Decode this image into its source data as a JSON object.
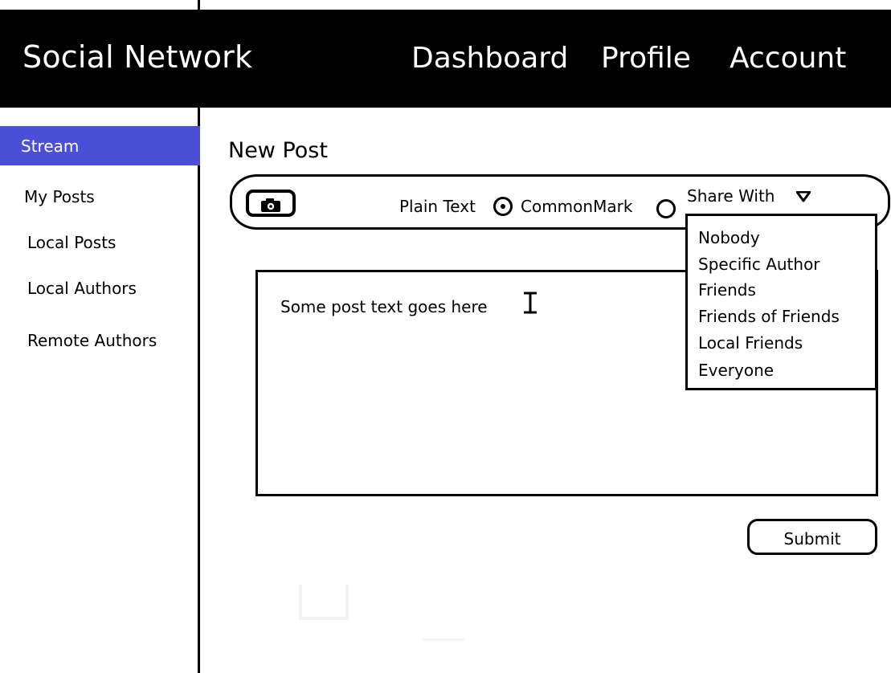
{
  "header": {
    "brand": "Social Network",
    "nav": [
      "Dashboard",
      "Profile",
      "Account"
    ]
  },
  "sidebar": {
    "items": [
      {
        "label": "Stream",
        "active": true
      },
      {
        "label": "My Posts",
        "active": false
      },
      {
        "label": "Local Posts",
        "active": false
      },
      {
        "label": "Local Authors",
        "active": false
      },
      {
        "label": "Remote Authors",
        "active": false
      }
    ]
  },
  "main": {
    "title": "New Post",
    "toolbar": {
      "camera_icon": "camera-icon",
      "format_options": [
        {
          "label": "Plain Text",
          "selected": true
        },
        {
          "label": "CommonMark",
          "selected": false
        }
      ],
      "share_label": "Share With",
      "share_icon": "caret-down-icon",
      "share_options": [
        "Nobody",
        "Specific Author",
        "Friends",
        "Friends of Friends",
        "Local Friends",
        "Everyone"
      ]
    },
    "editor": {
      "text": "Some post text goes here",
      "cursor_icon": "text-cursor-icon"
    },
    "submit_label": "Submit"
  },
  "colors": {
    "header_bg": "#000000",
    "header_text": "#ffffff",
    "sidebar_active": "#4a4fd8"
  }
}
